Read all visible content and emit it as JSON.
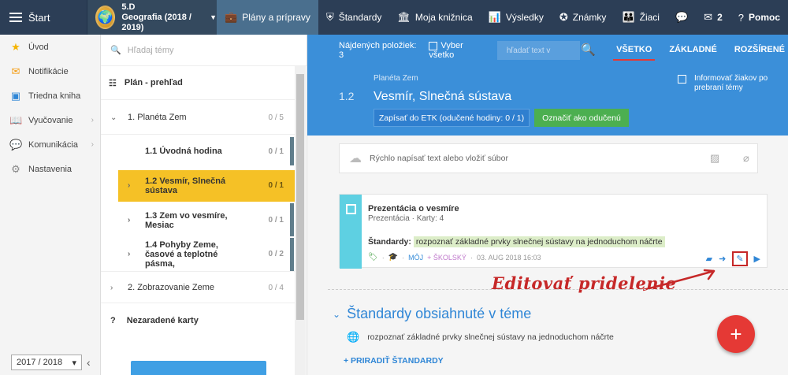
{
  "topbar": {
    "brand": "Štart",
    "class_code": "5.D",
    "class_subject": "Geografia (2018 / 2019)",
    "nav": [
      {
        "label": "Plány a prípravy",
        "icon": "briefcase-icon",
        "glyph": "💼",
        "active": true
      },
      {
        "label": "Štandardy",
        "icon": "shield-icon",
        "glyph": "⛨"
      },
      {
        "label": "Moja knižnica",
        "icon": "library-icon",
        "glyph": "🏛"
      },
      {
        "label": "Výsledky",
        "icon": "bar-chart-icon",
        "glyph": "📊"
      },
      {
        "label": "Známky",
        "icon": "grade-badge-icon",
        "glyph": "✪"
      },
      {
        "label": "Žiaci",
        "icon": "students-icon",
        "glyph": "👪"
      },
      {
        "label": "",
        "icon": "chat-icon",
        "glyph": "💬"
      },
      {
        "label": "2",
        "icon": "mail-icon",
        "glyph": "✉"
      },
      {
        "label": "Pomoc",
        "icon": "help-icon",
        "glyph": "?"
      }
    ]
  },
  "sidebar": {
    "items": [
      {
        "label": "Úvod",
        "icon": "star-icon",
        "glyph": "★",
        "color": "#f5b400"
      },
      {
        "label": "Notifikácie",
        "icon": "envelope-icon",
        "glyph": "✉",
        "color": "#f39c12"
      },
      {
        "label": "Triedna kniha",
        "icon": "class-book-icon",
        "glyph": "▣",
        "color": "#2f86d6"
      },
      {
        "label": "Vyučovanie",
        "icon": "book-icon",
        "glyph": "📖",
        "color": "#2f86d6",
        "chevron": true
      },
      {
        "label": "Komunikácia",
        "icon": "chat-bubbles-icon",
        "glyph": "💬",
        "color": "#d9534f",
        "chevron": true
      },
      {
        "label": "Nastavenia",
        "icon": "gear-icon",
        "glyph": "⚙",
        "color": "#888"
      }
    ],
    "year": "2017 / 2018"
  },
  "topics": {
    "search_placeholder": "Hľadaj témy",
    "overview": "Plán - prehľad",
    "rows": [
      {
        "label": "1. Planéta Zem",
        "count": "0 / 5"
      },
      {
        "label": "1.1 Úvodná hodina",
        "count": "0 / 1"
      },
      {
        "label": "1.2 Vesmír, Slnečná sústava",
        "count": "0 / 1"
      },
      {
        "label": "1.3 Zem vo vesmíre, Mesiac",
        "count": "0 / 1"
      },
      {
        "label": "1.4 Pohyby Zeme, časové a teplotné pásma,",
        "count": "0 / 2"
      },
      {
        "label": "2. Zobrazovanie Zeme",
        "count": "0 / 4"
      }
    ],
    "unassigned": "Nezaradené karty"
  },
  "main": {
    "found": "Nájdených položiek: 3",
    "select_all": "Vyber všetko",
    "filter_placeholder": "hľadať text v",
    "tabs": [
      "VŠETKO",
      "ZÁKLADNÉ",
      "ROZŠÍRENÉ"
    ],
    "topic_parent": "Planéta Zem",
    "topic_number": "1.2",
    "topic_title": "Vesmír, Slnečná sústava",
    "btn_etk": "Zapísať do ETK (odučené hodiny: 0 / 1)",
    "btn_done": "Označiť ako odučenú",
    "inform": "Informovať žiakov po prebraní témy",
    "composer_placeholder": "Rýchlo napísať text alebo vložiť súbor",
    "card": {
      "title": "Prezentácia o vesmíre",
      "subtitle": "Prezentácia · Karty: 4",
      "std_label": "Štandardy:",
      "std_value": "rozpoznať základné prvky slnečnej sústavy na jednoduchom náčrte",
      "owner": "MÔJ",
      "school": "+ ŠKOLSKÝ",
      "date": "03. AUG 2018 16:03"
    },
    "annotation": "Editovať pridelenie",
    "std_heading": "Štandardy obsiahnuté v téme",
    "std_item": "rozpoznať základné prvky slnečnej sústavy na jednoduchom náčrte",
    "assign": "+ PRIRADIŤ ŠTANDARDY",
    "fab": "+"
  },
  "colors": {
    "topbar": "#2c3e56",
    "header_blue": "#3b8fd9",
    "active_topic": "#f5c126",
    "annotation_red": "#c62828"
  }
}
